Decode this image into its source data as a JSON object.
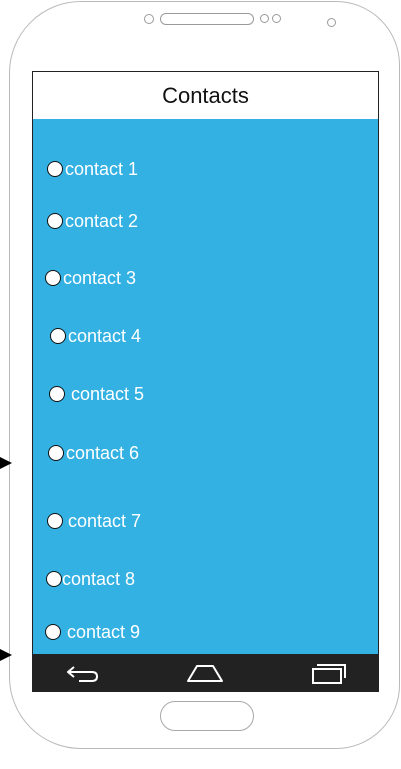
{
  "header": {
    "title": "Contacts"
  },
  "contacts": [
    "contact 1",
    "contact 2",
    "contact 3",
    "contact 4",
    "contact 5",
    "contact 6",
    "contact 7",
    "contact 8",
    "contact 9"
  ],
  "navbar": {
    "icons": [
      "back-icon",
      "home-icon",
      "recent-apps-icon"
    ]
  },
  "colors": {
    "list_background": "#34b1e3",
    "navbar_background": "#222222",
    "text_on_list": "#ffffff"
  }
}
